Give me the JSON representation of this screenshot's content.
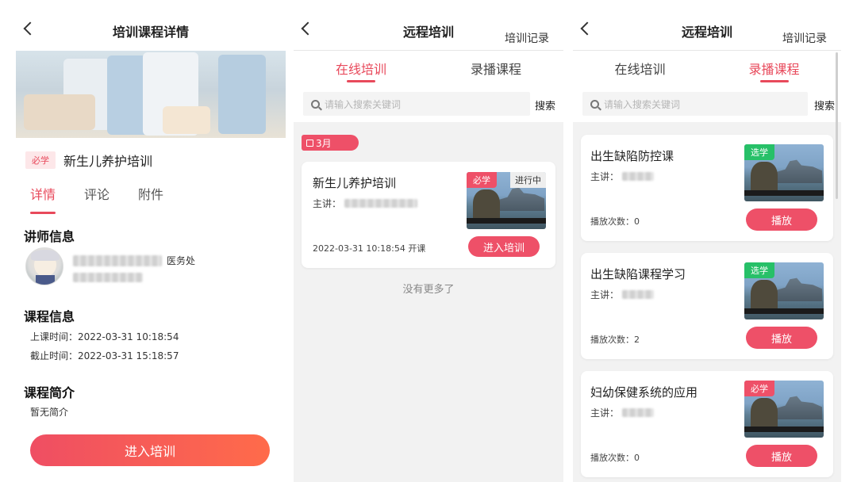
{
  "s1": {
    "title": "培训课程详情",
    "required_tag": "必学",
    "course_name": "新生儿养护培训",
    "tabs": [
      "详情",
      "评论",
      "附件"
    ],
    "lecturer_section": "讲师信息",
    "lecturer_dept": "医务处",
    "course_section": "课程信息",
    "start_time": "上课时间：2022-03-31 10:18:54",
    "end_time": "截止时间：2022-03-31 15:18:57",
    "intro_section": "课程简介",
    "intro_text": "暂无简介",
    "enter_button": "进入培训"
  },
  "s2": {
    "title": "远程培训",
    "right_link": "培训记录",
    "tabs": [
      "在线培训",
      "录播课程"
    ],
    "search_placeholder": "请输入搜索关键词",
    "search_button": "搜索",
    "month_tag": "3月",
    "card": {
      "title": "新生儿养护培训",
      "lecturer_label": "主讲：",
      "tag": "必学",
      "status": "进行中",
      "datetime": "2022-03-31 10:18:54 开课",
      "button": "进入培训"
    },
    "no_more": "没有更多了"
  },
  "s3": {
    "title": "远程培训",
    "right_link": "培训记录",
    "tabs": [
      "在线培训",
      "录播课程"
    ],
    "search_placeholder": "请输入搜索关键词",
    "search_button": "搜索",
    "cards": [
      {
        "title": "出生缺陷防控课",
        "lecturer_label": "主讲：",
        "tag": "选学",
        "plays": "播放次数：0",
        "button": "播放"
      },
      {
        "title": "出生缺陷课程学习",
        "lecturer_label": "主讲：",
        "tag": "选学",
        "plays": "播放次数：2",
        "button": "播放"
      },
      {
        "title": "妇幼保健系统的应用",
        "lecturer_label": "主讲：",
        "tag": "必学",
        "plays": "播放次数：0",
        "button": "播放"
      }
    ]
  },
  "colors": {
    "accent": "#e8495b",
    "green_tag": "#27c068",
    "button_gradient_end": "#ff6b4a"
  }
}
